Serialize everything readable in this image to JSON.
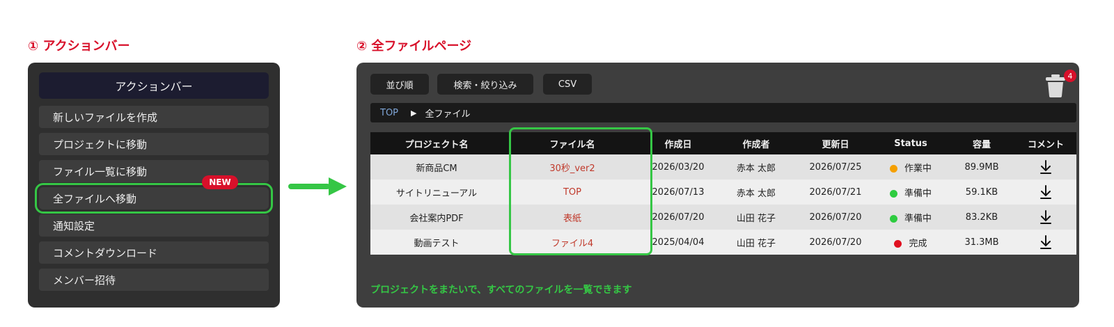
{
  "section1": {
    "title": "① アクションバー"
  },
  "section2": {
    "title": "② 全ファイルページ"
  },
  "action_bar": {
    "header": "アクションバー",
    "items": [
      {
        "label": "新しいファイルを作成"
      },
      {
        "label": "プロジェクトに移動"
      },
      {
        "label": "ファイル一覧に移動"
      },
      {
        "label": "全ファイルへ移動",
        "highlighted": true
      },
      {
        "label": "通知設定"
      },
      {
        "label": "コメントダウンロード"
      },
      {
        "label": "メンバー招待"
      }
    ],
    "badge": "NEW"
  },
  "toolbar": {
    "sort_label": "並び順",
    "filter_label": "検索・絞り込み",
    "csv_label": "CSV",
    "trash_icon": "trash-icon",
    "trash_count": "4"
  },
  "breadcrumb": {
    "root": "TOP",
    "separator": "▶",
    "current": "全ファイル"
  },
  "table": {
    "headers": [
      "プロジェクト名",
      "ファイル名",
      "作成日",
      "作成者",
      "更新日",
      "Status",
      "容量",
      "コメント"
    ],
    "rows": [
      {
        "project": "新商品CM",
        "file": "30秒_ver2",
        "created": "2026/03/20",
        "author": "赤本 太郎",
        "updated": "2026/07/25",
        "status": "作業中",
        "status_color": "#f5a000",
        "size": "89.9MB"
      },
      {
        "project": "サイトリニューアル",
        "file": "TOP",
        "created": "2026/07/13",
        "author": "赤本 太郎",
        "updated": "2026/07/21",
        "status": "準備中",
        "status_color": "#2ecc40",
        "size": "59.1KB"
      },
      {
        "project": "会社案内PDF",
        "file": "表紙",
        "created": "2026/07/20",
        "author": "山田 花子",
        "updated": "2026/07/20",
        "status": "準備中",
        "status_color": "#2ecc40",
        "size": "83.2KB"
      },
      {
        "project": "動画テスト",
        "file": "ファイル4",
        "created": "2025/04/04",
        "author": "山田 花子",
        "updated": "2026/07/20",
        "status": "完成",
        "status_color": "#e01020",
        "size": "31.3MB"
      }
    ]
  },
  "caption": "プロジェクトをまたいで、すべてのファイルを一覧できます",
  "colors": {
    "accent_red": "#d8102a",
    "highlight_green": "#35c645"
  }
}
